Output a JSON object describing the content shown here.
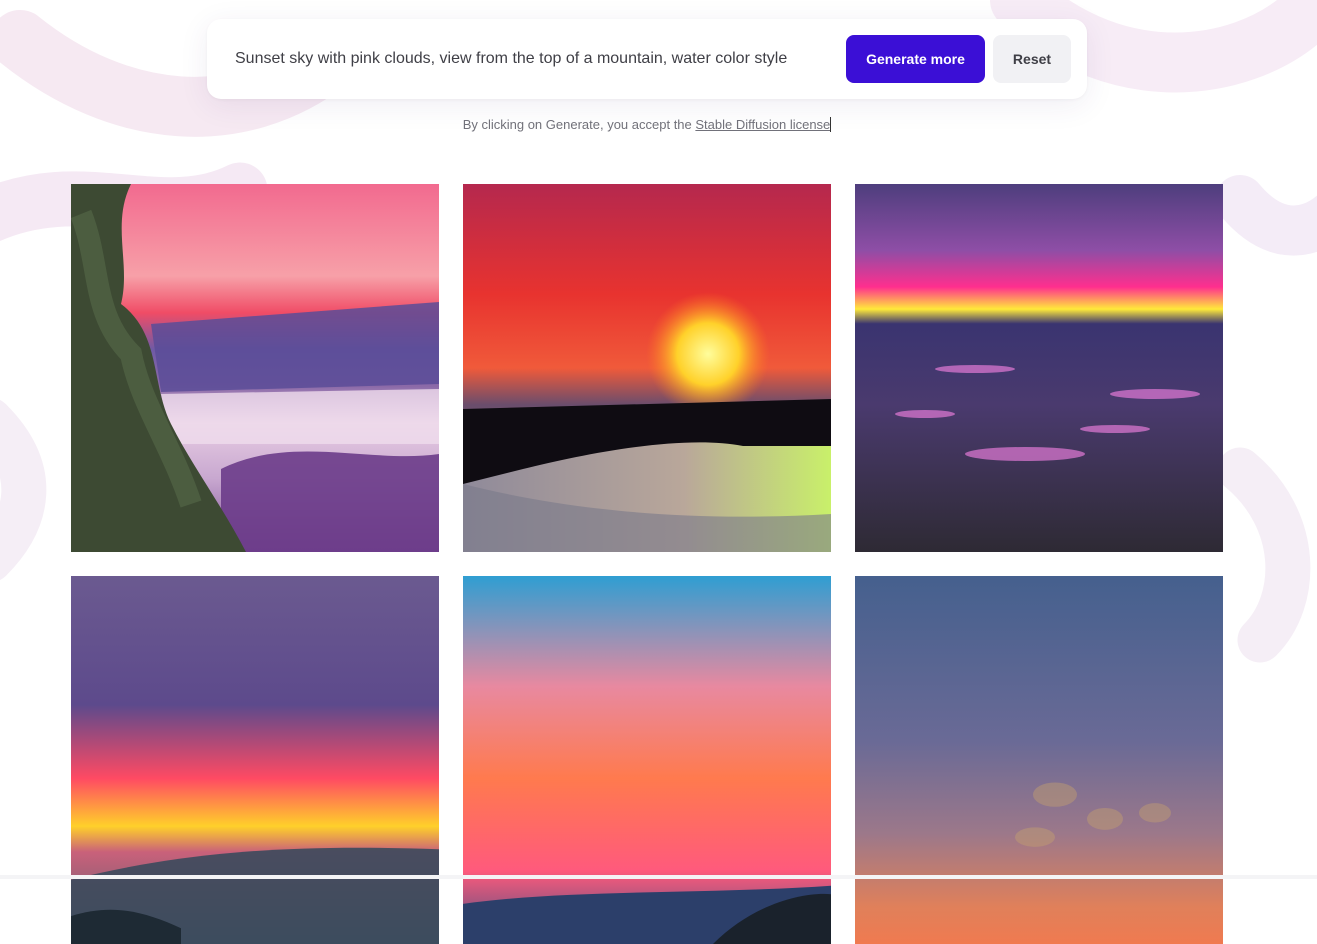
{
  "prompt": {
    "text": "Sunset sky with pink clouds, view from the top of a mountain, water color style"
  },
  "buttons": {
    "generate_label": "Generate more",
    "reset_label": "Reset"
  },
  "license": {
    "prefix": "By clicking on Generate, you accept the",
    "link_text": "Stable Diffusion license"
  },
  "colors": {
    "accent": "#3b0fd6",
    "reset_bg": "#f1f1f4"
  },
  "images": [
    {
      "name": "generated-image-1",
      "alt": "watercolor sunset with pine trees and purple hills"
    },
    {
      "name": "generated-image-2",
      "alt": "watercolor red sunset over a lake"
    },
    {
      "name": "generated-image-3",
      "alt": "purple sky with bright magenta horizon over a city"
    },
    {
      "name": "generated-image-4",
      "alt": "dark purple clouds with golden sunset over mountains"
    },
    {
      "name": "generated-image-5",
      "alt": "blue sky with orange pink clouds over a valley"
    },
    {
      "name": "generated-image-6",
      "alt": "textured blue to orange gradient sky"
    }
  ]
}
